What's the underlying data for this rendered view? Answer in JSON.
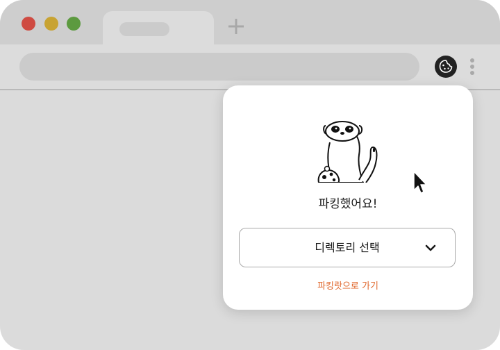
{
  "browser": {
    "icons": {
      "close": "close-dot",
      "minimize": "minimize-dot",
      "maximize": "maximize-dot",
      "new_tab": "plus-icon",
      "extension": "cookie-icon",
      "more": "kebab-menu-icon"
    },
    "colors": {
      "close": "#cf4b42",
      "minimize": "#c8a332",
      "maximize": "#5c9a3f"
    }
  },
  "popup": {
    "illustration": "meerkat-mascot",
    "status": "파킹했어요!",
    "directory_select": {
      "selected": "디렉토리 선택",
      "icon": "chevron-down-icon"
    },
    "go_link": "파킹랏으로 가기",
    "accent_color": "#e0662a"
  }
}
